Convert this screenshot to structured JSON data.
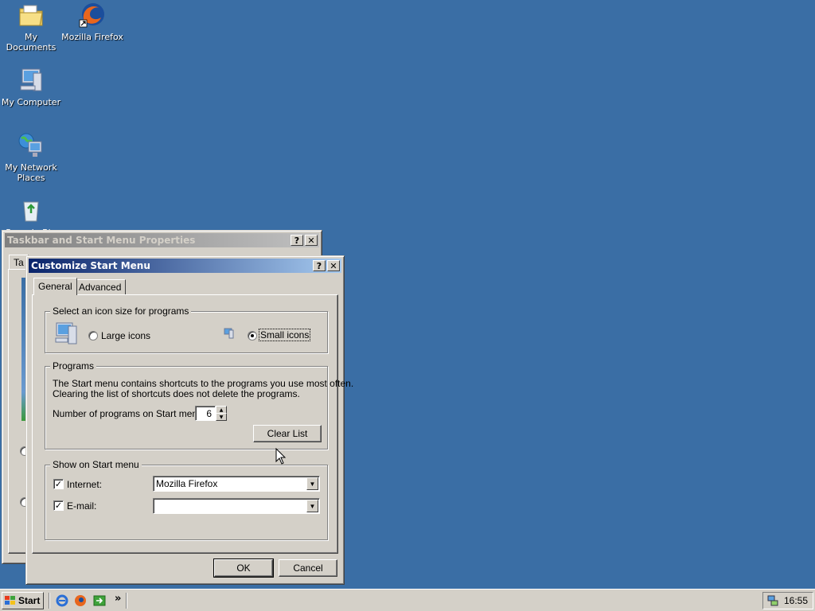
{
  "desktop": {
    "icons": [
      {
        "label": "My Documents"
      },
      {
        "label": "Mozilla Firefox"
      },
      {
        "label": "My Computer"
      },
      {
        "label": "My Network Places"
      },
      {
        "label": "Recycle Bin"
      }
    ]
  },
  "back_window": {
    "title": "Taskbar and Start Menu Properties",
    "tab_partial": "Ta"
  },
  "dialog": {
    "title": "Customize Start Menu",
    "help": "?",
    "close": "✕",
    "tabs": [
      {
        "label": "General"
      },
      {
        "label": "Advanced"
      }
    ],
    "icon_size_group": {
      "title": "Select an icon size for programs",
      "large_label": "Large icons",
      "small_label": "Small icons",
      "selected": "Small icons"
    },
    "programs_group": {
      "title": "Programs",
      "description_line1": "The Start menu contains shortcuts to the programs you use most often.",
      "description_line2": "Clearing the list of shortcuts does not delete the programs.",
      "count_label": "Number of programs on Start menu:",
      "count_value": "6",
      "clear_button": "Clear List"
    },
    "show_group": {
      "title": "Show on Start menu",
      "internet_label": "Internet:",
      "internet_checked": true,
      "internet_value": "Mozilla Firefox",
      "email_label": "E-mail:",
      "email_checked": true,
      "email_value": ""
    },
    "ok_button": "OK",
    "cancel_button": "Cancel"
  },
  "taskbar": {
    "start_label": "Start",
    "chevron": "»",
    "clock": "16:55"
  },
  "colors": {
    "desktop": "#3a6ea5",
    "face": "#d4d0c8",
    "active_title": "#0a246a"
  }
}
